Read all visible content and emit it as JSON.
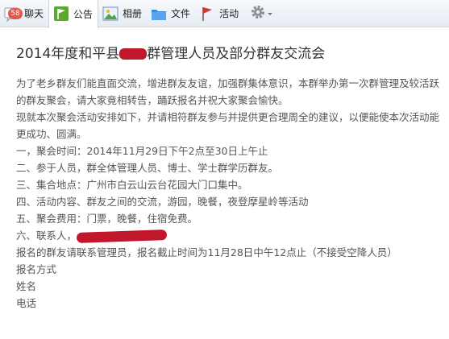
{
  "tabs": [
    {
      "label": "聊天",
      "icon": "chat-icon",
      "badge": "58"
    },
    {
      "label": "公告",
      "icon": "announcement-flag-icon"
    },
    {
      "label": "相册",
      "icon": "photo-album-icon"
    },
    {
      "label": "文件",
      "icon": "folder-icon"
    },
    {
      "label": "活动",
      "icon": "event-flag-icon"
    }
  ],
  "settings_icon": "gear-icon",
  "colors": {
    "accent": "#3a8be0",
    "redaction": "#c2162a",
    "badge": "#e8524f"
  },
  "notice": {
    "title_pre": "2014年度和平县",
    "title_post": "群管理人员及部分群友交流会",
    "para1": "为了老乡群友们能直面交流，增进群友友谊，加强群集体意识，本群举办第一次群管理及较活跃的群友聚会，请大家竟相转告，踊跃报名并祝大家聚会愉快。",
    "para2": "现就本次聚会活动安排如下，并请相符群友参与并提供更合理周全的建议，以便能使本次活动能更成功、圆满。",
    "items": [
      "一，聚会时间：2014年11月29日下午2点至30日上午止",
      "二、参于人员，群全体管理人员、博士、学士群学历群友。",
      "三、集合地点：广州市白云山云台花园大门口集中。",
      "四、活动内容、群友之间的交流，游园，晚餐，夜登摩星岭等活动",
      "五、聚会费用：门票，晚餐，住宿免费。"
    ],
    "contact_label": "六、联系人，",
    "signup": "报名的群友请联系管理员，报名截止时间为11月28日中午12点止（不接受空降人员）",
    "fields": [
      "报名方式",
      "姓名",
      "电话"
    ]
  }
}
